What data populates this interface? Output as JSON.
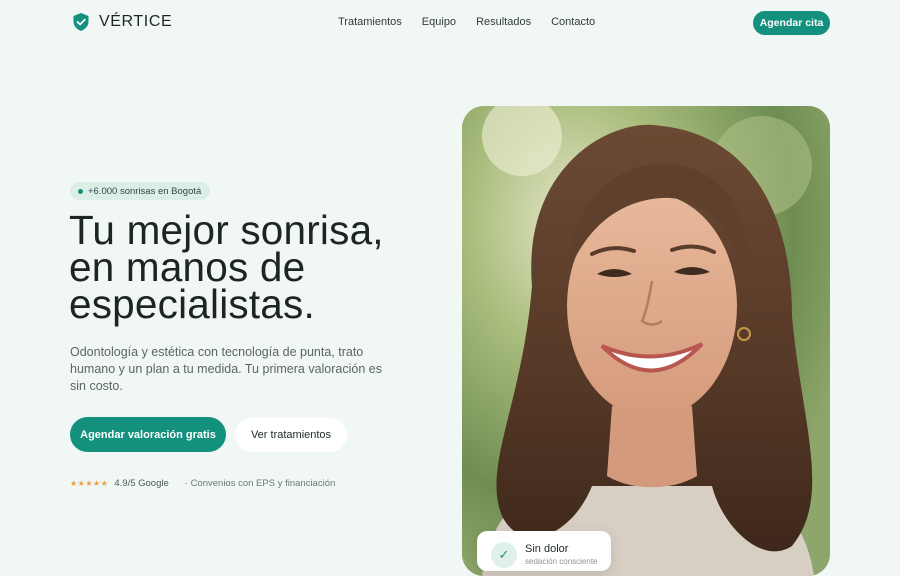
{
  "brand": {
    "name": "VÉRTICE",
    "accent": "#14917e",
    "logo_icon": "shield-check-icon"
  },
  "nav": {
    "items": [
      "Tratamientos",
      "Equipo",
      "Resultados",
      "Contacto"
    ]
  },
  "header": {
    "cta_label": "Agendar cita"
  },
  "hero": {
    "badge": "+6.000 sonrisas en Bogotá",
    "headline": [
      "Tu mejor sonrisa,",
      "en manos de",
      "especialistas."
    ],
    "description": "Odontología y estética con tecnología de punta, trato humano y un plan a tu medida. Tu primera valoración es sin costo.",
    "primary_cta": "Agendar valoración gratis",
    "secondary_cta": "Ver tratamientos",
    "stars": "★★★★★",
    "rating": "4.9/5 Google",
    "trust_note": "· Convenios con EPS y financiación"
  },
  "feature_card": {
    "title": "Sin dolor",
    "subtitle": "sedación consciente",
    "icon": "check-icon"
  }
}
